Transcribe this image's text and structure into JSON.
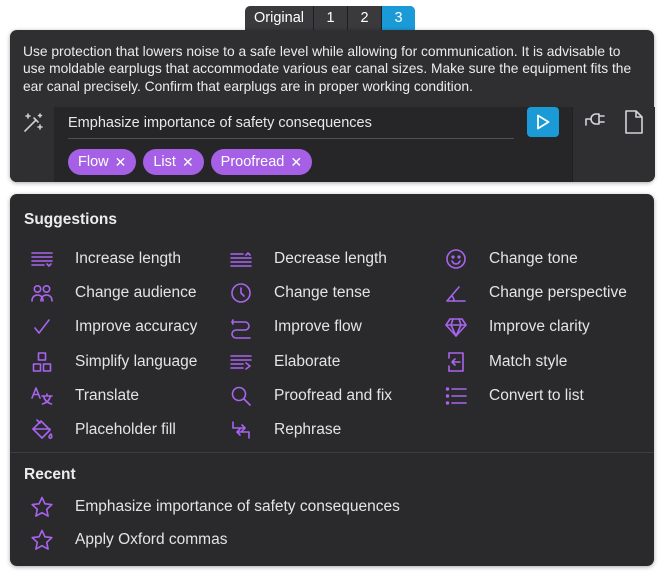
{
  "tabs": [
    {
      "label": "Original",
      "active": false
    },
    {
      "label": "1",
      "active": false
    },
    {
      "label": "2",
      "active": false
    },
    {
      "label": "3",
      "active": true
    }
  ],
  "editor": {
    "output_text": "Use protection that lowers noise to a safe level while allowing for communication. It is advisable to use moldable earplugs that accommodate various ear canal sizes. Make sure the equipment fits the ear canal precisely. Confirm that earplugs are in proper working condition.",
    "prompt_value": "Emphasize importance of safety consequences",
    "chips": [
      "Flow",
      "List",
      "Proofread"
    ],
    "chip_remove_symbol": "✕"
  },
  "suggestions": {
    "title": "Suggestions",
    "columns": [
      [
        {
          "label": "Increase length",
          "icon": "increase-length-icon"
        },
        {
          "label": "Change audience",
          "icon": "audience-icon"
        },
        {
          "label": "Improve accuracy",
          "icon": "checkmark-icon"
        },
        {
          "label": "Simplify language",
          "icon": "simplify-icon"
        },
        {
          "label": "Translate",
          "icon": "translate-icon"
        },
        {
          "label": "Placeholder fill",
          "icon": "paint-bucket-icon"
        }
      ],
      [
        {
          "label": "Decrease length",
          "icon": "decrease-length-icon"
        },
        {
          "label": "Change tense",
          "icon": "clock-icon"
        },
        {
          "label": "Improve flow",
          "icon": "flow-icon"
        },
        {
          "label": "Elaborate",
          "icon": "elaborate-icon"
        },
        {
          "label": "Proofread and fix",
          "icon": "magnifier-icon"
        },
        {
          "label": "Rephrase",
          "icon": "rephrase-icon"
        }
      ],
      [
        {
          "label": "Change tone",
          "icon": "smiley-icon"
        },
        {
          "label": "Change perspective",
          "icon": "angle-icon"
        },
        {
          "label": "Improve clarity",
          "icon": "diamond-icon"
        },
        {
          "label": "Match style",
          "icon": "match-style-icon"
        },
        {
          "label": "Convert to list",
          "icon": "list-icon"
        }
      ]
    ]
  },
  "recent": {
    "title": "Recent",
    "items": [
      {
        "label": "Emphasize importance of safety consequences",
        "icon": "star-icon"
      },
      {
        "label": "Apply Oxford commas",
        "icon": "star-icon"
      }
    ]
  },
  "colors": {
    "accent_blue": "#1a9ad6",
    "chip_purple": "#a560e6",
    "icon_purple": "#a864ee",
    "panel_bg": "#2a2a2c"
  }
}
